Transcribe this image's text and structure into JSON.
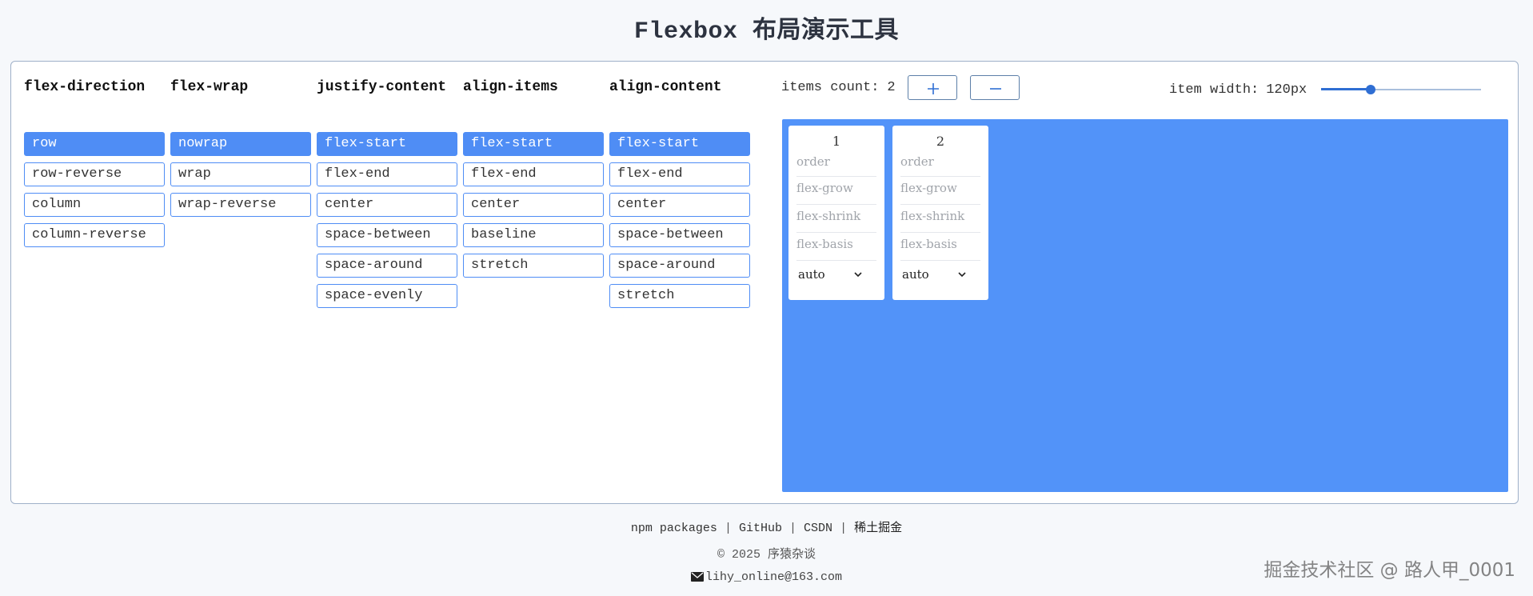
{
  "title": "Flexbox 布局演示工具",
  "groups": [
    {
      "title": "flex-direction",
      "options": [
        "row",
        "row-reverse",
        "column",
        "column-reverse"
      ],
      "selected": "row"
    },
    {
      "title": "flex-wrap",
      "options": [
        "nowrap",
        "wrap",
        "wrap-reverse"
      ],
      "selected": "nowrap"
    },
    {
      "title": "justify-content",
      "options": [
        "flex-start",
        "flex-end",
        "center",
        "space-between",
        "space-around",
        "space-evenly"
      ],
      "selected": "flex-start"
    },
    {
      "title": "align-items",
      "options": [
        "flex-start",
        "flex-end",
        "center",
        "baseline",
        "stretch"
      ],
      "selected": "flex-start"
    },
    {
      "title": "align-content",
      "options": [
        "flex-start",
        "flex-end",
        "center",
        "space-between",
        "space-around",
        "stretch"
      ],
      "selected": "flex-start"
    }
  ],
  "items_count": {
    "label": "items count:",
    "value": "2",
    "add_icon": "plus-icon",
    "remove_icon": "minus-icon"
  },
  "item_width": {
    "label": "item width:",
    "value_text": "120px",
    "slider_fraction": 0.31
  },
  "items": [
    {
      "number": "1",
      "order_placeholder": "order",
      "grow_placeholder": "flex-grow",
      "shrink_placeholder": "flex-shrink",
      "basis_placeholder": "flex-basis",
      "align_self": "auto"
    },
    {
      "number": "2",
      "order_placeholder": "order",
      "grow_placeholder": "flex-grow",
      "shrink_placeholder": "flex-shrink",
      "basis_placeholder": "flex-basis",
      "align_self": "auto"
    }
  ],
  "footer": {
    "links": [
      "npm packages",
      "GitHub",
      "CSDN",
      "稀土掘金"
    ],
    "separator": "|",
    "copyright": "© 2025 序猿杂谈",
    "email": "lihy_online@163.com",
    "email_icon": "mail-icon"
  },
  "watermark": "掘金技术社区 @ 路人甲_0001",
  "colors": {
    "accent": "#4f8df5",
    "container": "#5293f9",
    "slider": "#2f6ed3"
  }
}
